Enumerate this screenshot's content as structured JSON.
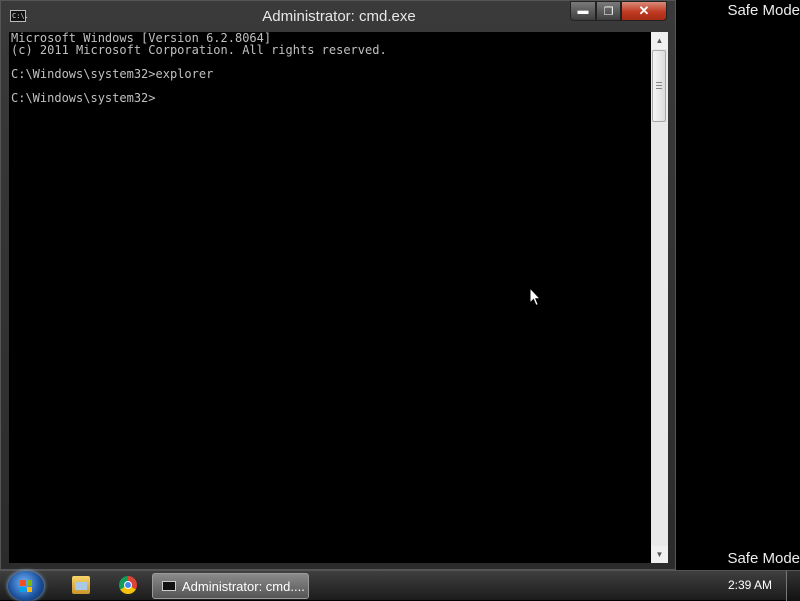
{
  "desktop": {
    "safe_mode_top": "Safe Mode",
    "safe_mode_bottom": "Safe Mode"
  },
  "window": {
    "title": "Administrator: cmd.exe",
    "icon_text": "C:\\.",
    "controls": {
      "minimize": "minimize",
      "maximize": "maximize",
      "close": "close"
    },
    "console_lines": [
      "Microsoft Windows [Version 6.2.8064]",
      "(c) 2011 Microsoft Corporation. All rights reserved.",
      "",
      "C:\\Windows\\system32>explorer",
      "",
      "C:\\Windows\\system32>"
    ],
    "scrollbar_icons": {
      "up": "arrow-up-icon",
      "down": "arrow-down-icon"
    }
  },
  "taskbar": {
    "pinned": [
      {
        "name": "windows-explorer",
        "icon": "folder-icon"
      },
      {
        "name": "google-chrome",
        "icon": "chrome-icon"
      }
    ],
    "active_task_label": "Administrator: cmd....",
    "clock": "2:39 AM"
  },
  "colors": {
    "console_bg": "#000000",
    "console_text": "#c0c0c0",
    "close_button": "#c03a22"
  }
}
